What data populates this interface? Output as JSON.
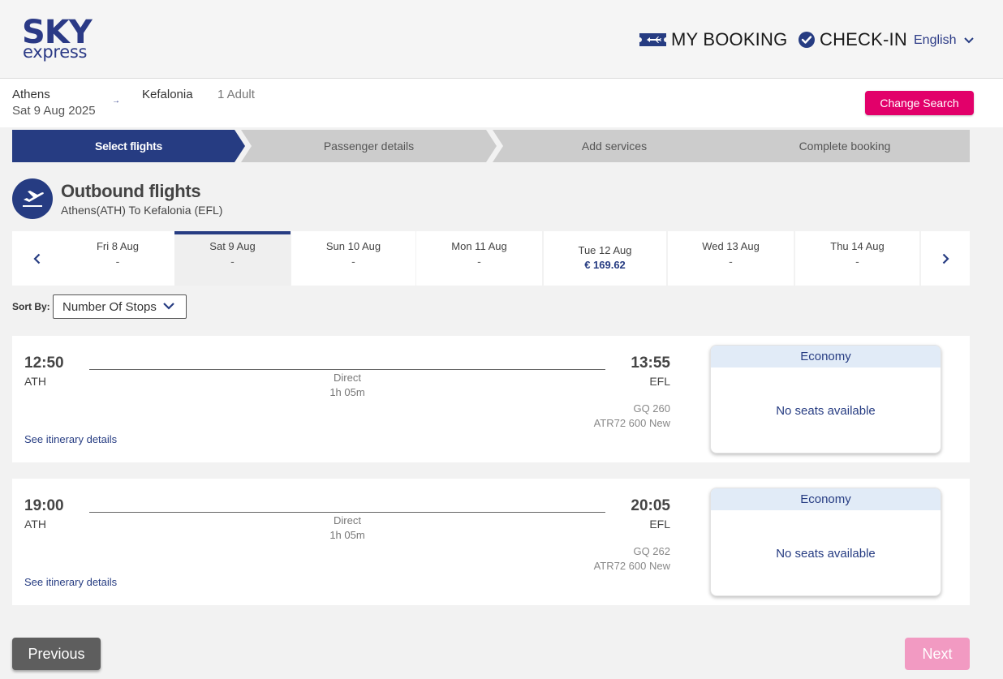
{
  "brand": {
    "logo_top": "SKY",
    "logo_bottom": "express",
    "color": "#2b3a86"
  },
  "header": {
    "my_booking": {
      "label": "MY BOOKING",
      "icon": "ticket-icon"
    },
    "check_in": {
      "label": "CHECK-IN",
      "icon": "check-circle-icon"
    },
    "language": "English"
  },
  "search_summary": {
    "from_city": "Athens",
    "date": "Sat 9 Aug 2025",
    "to_city": "Kefalonia",
    "passengers": "1 Adult",
    "change_button": "Change Search",
    "accent": "#e2006a"
  },
  "steps": [
    {
      "label": "Select flights",
      "active": true
    },
    {
      "label": "Passenger details",
      "active": false
    },
    {
      "label": "Add services",
      "active": false
    },
    {
      "label": "Complete booking",
      "active": false
    }
  ],
  "outbound": {
    "title": "Outbound flights",
    "route": "Athens(ATH) To Kefalonia (EFL)",
    "icon": "plane-departure-icon"
  },
  "dates": [
    {
      "label": "Fri 8 Aug",
      "price": "-"
    },
    {
      "label": "Sat 9 Aug",
      "price": "-",
      "selected": true
    },
    {
      "label": "Sun 10 Aug",
      "price": "-"
    },
    {
      "label": "Mon 11 Aug",
      "price": "-"
    },
    {
      "label": "Tue 12 Aug",
      "price": "€ 169.62"
    },
    {
      "label": "Wed 13 Aug",
      "price": "-"
    },
    {
      "label": "Thu 14 Aug",
      "price": "-"
    }
  ],
  "sort": {
    "label": "Sort By:",
    "selected": "Number Of Stops"
  },
  "flights": [
    {
      "dep_time": "12:50",
      "dep_code": "ATH",
      "arr_time": "13:55",
      "arr_code": "EFL",
      "stops": "Direct",
      "duration": "1h 05m",
      "flight_no": "GQ 260",
      "aircraft": "ATR72 600 New",
      "itinerary_link": "See itinerary details",
      "fare_class": "Economy",
      "fare_status": "No seats available"
    },
    {
      "dep_time": "19:00",
      "dep_code": "ATH",
      "arr_time": "20:05",
      "arr_code": "EFL",
      "stops": "Direct",
      "duration": "1h 05m",
      "flight_no": "GQ 262",
      "aircraft": "ATR72 600 New",
      "itinerary_link": "See itinerary details",
      "fare_class": "Economy",
      "fare_status": "No seats available"
    }
  ],
  "footer": {
    "previous": "Previous",
    "next": "Next"
  }
}
